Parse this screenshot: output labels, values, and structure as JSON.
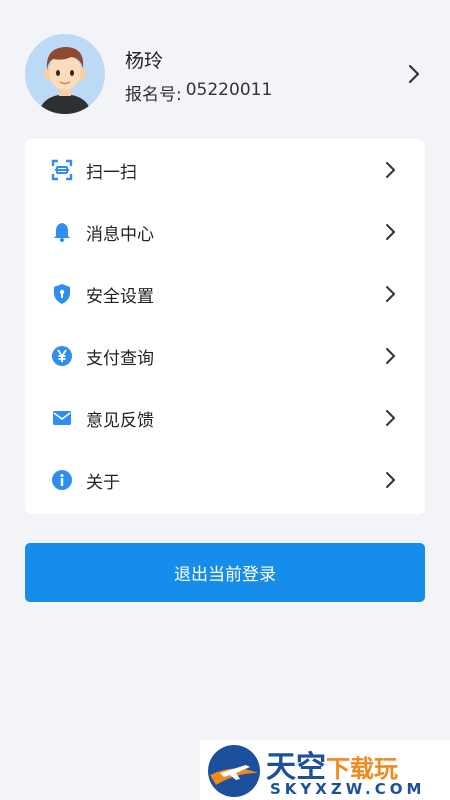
{
  "profile": {
    "name": "杨玲",
    "reg_label": "报名号:",
    "reg_number": "05220011"
  },
  "menu": {
    "items": [
      {
        "label": "扫一扫",
        "icon": "scan-icon"
      },
      {
        "label": "消息中心",
        "icon": "bell-icon"
      },
      {
        "label": "安全设置",
        "icon": "shield-icon"
      },
      {
        "label": "支付查询",
        "icon": "yen-icon"
      },
      {
        "label": "意见反馈",
        "icon": "mail-icon"
      },
      {
        "label": "关于",
        "icon": "info-icon"
      }
    ]
  },
  "logout": {
    "label": "退出当前登录"
  },
  "watermark": {
    "title_main": "天空",
    "title_accent": "下载玩",
    "subtitle": "SKYXZW.COM"
  },
  "colors": {
    "accent": "#168dea",
    "icon_blue": "#2f8ef0",
    "background": "#f3f4f8"
  }
}
